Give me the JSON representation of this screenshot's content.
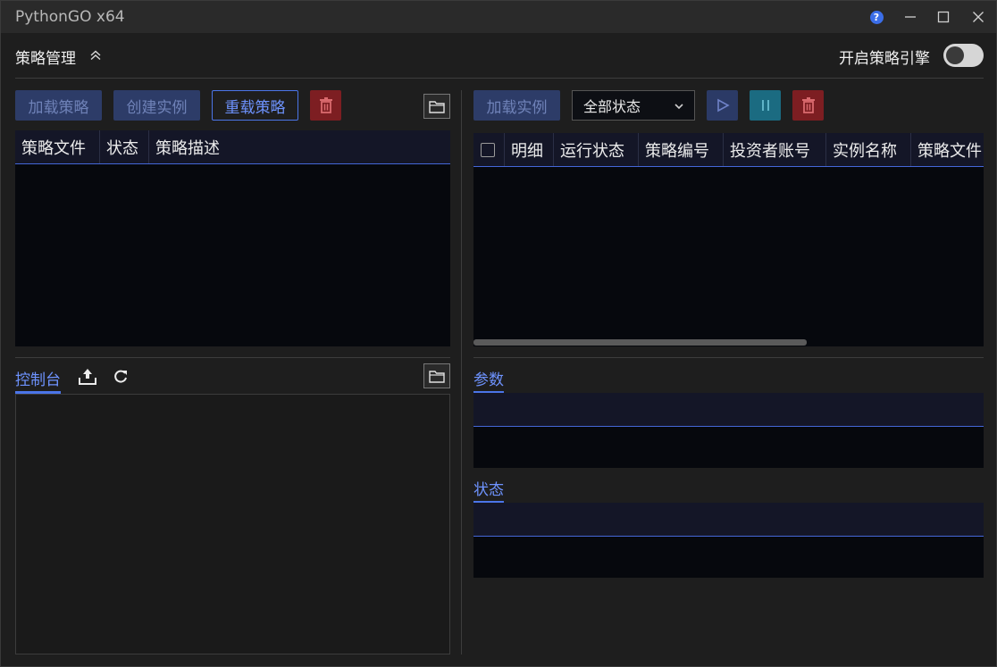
{
  "window": {
    "title": "PythonGO x64"
  },
  "header": {
    "title": "策略管理",
    "engine_toggle_label": "开启策略引擎",
    "engine_enabled": false
  },
  "left_toolbar": {
    "load_strategy": "加载策略",
    "create_instance": "创建实例",
    "reload_strategy": "重载策略"
  },
  "strategy_table": {
    "columns": [
      "策略文件",
      "状态",
      "策略描述"
    ],
    "rows": []
  },
  "console": {
    "tab_label": "控制台"
  },
  "right_toolbar": {
    "load_instance": "加载实例",
    "status_filter": "全部状态"
  },
  "instance_table": {
    "columns": [
      "明细",
      "运行状态",
      "策略编号",
      "投资者账号",
      "实例名称",
      "策略文件"
    ],
    "rows": []
  },
  "params_section": {
    "label": "参数"
  },
  "status_section": {
    "label": "状态"
  },
  "colors": {
    "accent": "#4b75e8",
    "danger": "#7d1e22",
    "pause": "#1b6b81"
  }
}
